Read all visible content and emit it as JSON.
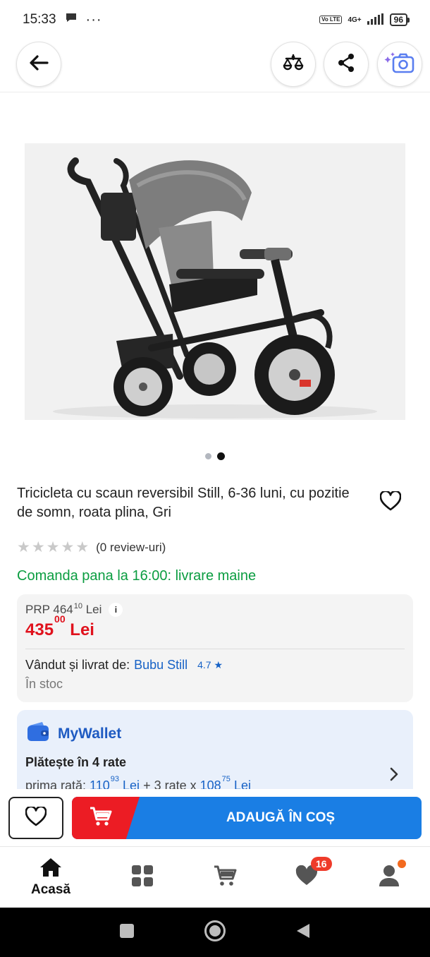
{
  "status_bar": {
    "time": "15:33",
    "network": "4G+",
    "volte": "Vo LTE",
    "battery": "96"
  },
  "top_bar": {
    "back_icon": "arrow-left-icon",
    "compare_icon": "scale-balance-icon",
    "share_icon": "share-icon",
    "camera_search_icon": "camera-sparkle-icon"
  },
  "carousel": {
    "total": 2,
    "active_index": 1
  },
  "product": {
    "title": "Tricicleta cu scaun reversibil Still, 6-36 luni, cu pozitie de somn, roata plina, Gri",
    "rating_stars": 0,
    "review_text": "(0 review-uri)",
    "delivery_text": "Comanda pana la 16:00: livrare maine"
  },
  "price": {
    "prp_label": "PRP 464",
    "prp_decimals": "10",
    "prp_currency": "Lei",
    "current_int": "435",
    "current_dec": "00",
    "current_currency": "Lei",
    "seller_label": "Vândut și livrat de:",
    "seller_name": "Bubu Still",
    "seller_rating": "4.7",
    "stock": "În stoc"
  },
  "wallet": {
    "name": "MyWallet",
    "installments_title": "Plătește în 4 rate",
    "first_rate_label": "prima rată:",
    "first_rate_int": "110",
    "first_rate_dec": "93",
    "first_rate_currency": "Lei",
    "rest_label": "+ 3 rate x",
    "rest_int": "108",
    "rest_dec": "75",
    "rest_currency": "Lei"
  },
  "actions": {
    "add_to_cart": "ADAUGĂ ÎN COȘ"
  },
  "bottom_nav": {
    "home_label": "Acasă",
    "favorites_badge": "16"
  },
  "colors": {
    "accent_blue": "#1a7ee4",
    "accent_red": "#ec1c24",
    "price_red": "#e0121d",
    "delivery_green": "#0b9d41",
    "link_blue": "#1762c6"
  }
}
